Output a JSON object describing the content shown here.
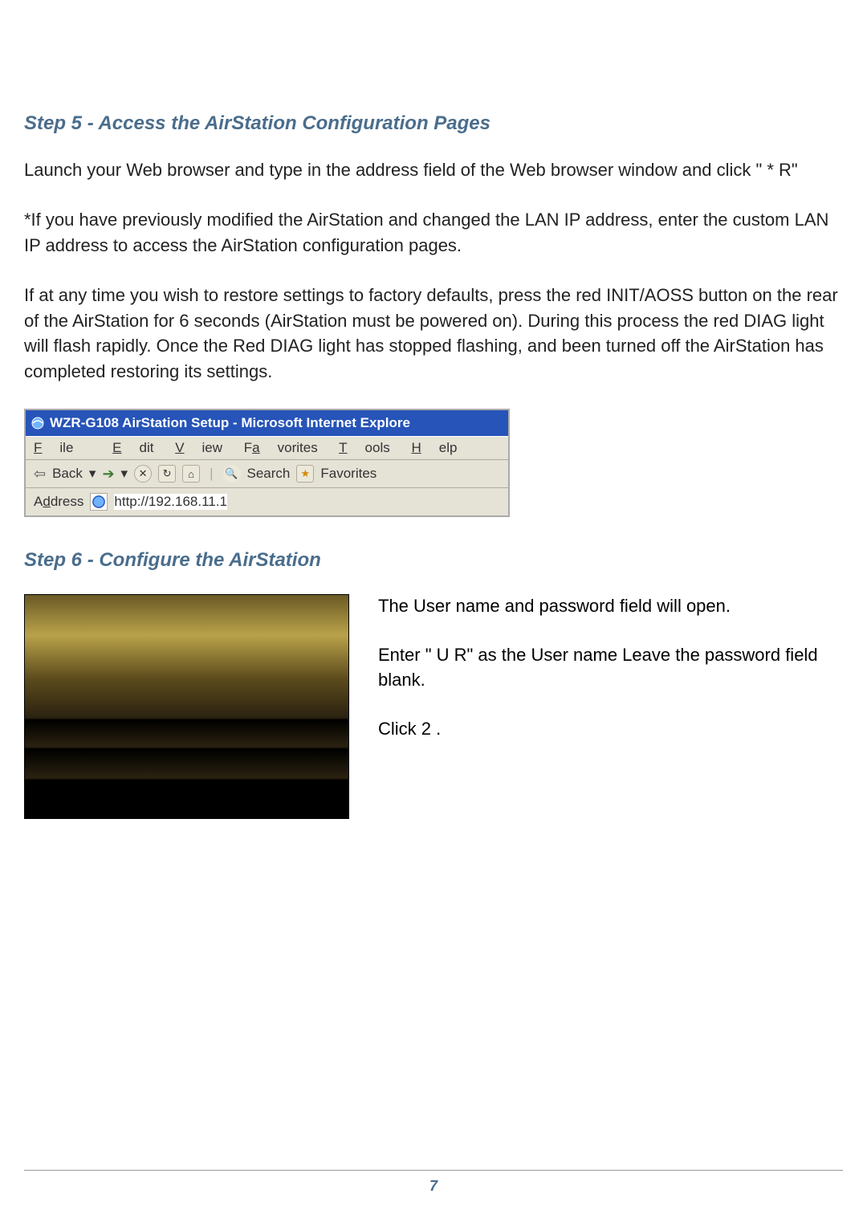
{
  "step5": {
    "heading": "Step 5 - Access the AirStation Configuration Pages",
    "p1": "Launch your Web browser and type                           in the address field of the Web browser window and click  \" * R\"",
    "p2": "*If you have previously modified the AirStation and changed the LAN IP address, enter the custom LAN IP address to access the AirStation configuration pages.",
    "p3": "If at any time you wish to restore settings to factory defaults, press the red INIT/AOSS button on the rear of the AirStation for 6 seconds (AirStation must be powered on). During this process the red DIAG light will flash rapidly.  Once the Red DIAG light has stopped flashing, and been turned off the AirStation has completed restoring its settings."
  },
  "ie": {
    "title": "WZR-G108  AirStation Setup - Microsoft Internet Explore",
    "menu": {
      "file": "File",
      "edit": "Edit",
      "view": "View",
      "fav": "Favorites",
      "tools": "Tools",
      "help": "Help"
    },
    "toolbar": {
      "back": "Back",
      "search": "Search",
      "favorites": "Favorites"
    },
    "address": {
      "label": "Address",
      "url": "http://192.168.11.1"
    }
  },
  "step6": {
    "heading": "Step 6 - Configure the AirStation",
    "p1": "The User name and password field will open.",
    "p2": "Enter \" U R\" as the User name Leave the password field blank.",
    "p3": "Click  2 ."
  },
  "page_number": "7"
}
